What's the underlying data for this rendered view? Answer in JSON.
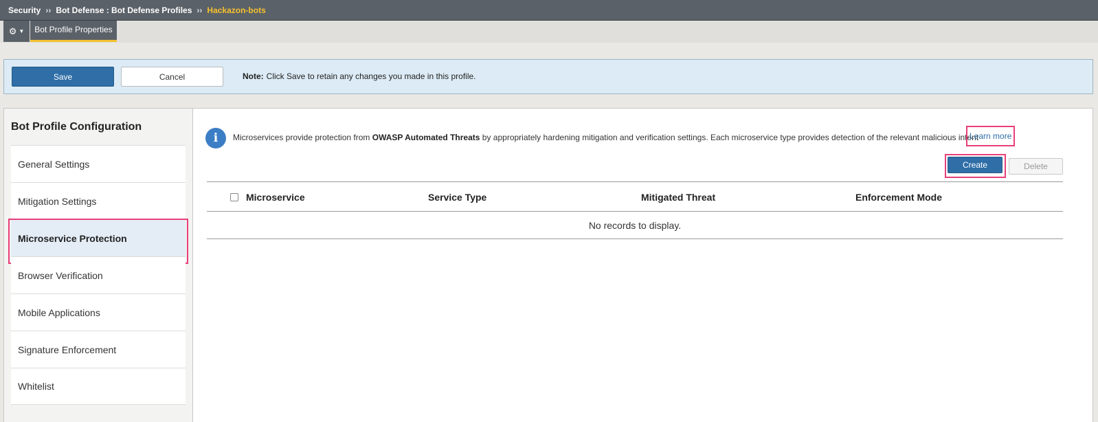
{
  "breadcrumb": {
    "items": [
      "Security",
      "Bot Defense : Bot Defense Profiles"
    ],
    "current": "Hackazon-bots",
    "separator": "››"
  },
  "tabbar": {
    "gear_icon": "gear-icon",
    "active_tab": "Bot Profile Properties"
  },
  "notice": {
    "save_label": "Save",
    "cancel_label": "Cancel",
    "note_label": "Note:",
    "note_text": "Click Save to retain any changes you made in this profile."
  },
  "sidebar": {
    "title": "Bot Profile Configuration",
    "items": [
      {
        "label": "General Settings"
      },
      {
        "label": "Mitigation Settings"
      },
      {
        "label": "Microservice Protection"
      },
      {
        "label": "Browser Verification"
      },
      {
        "label": "Mobile Applications"
      },
      {
        "label": "Signature Enforcement"
      },
      {
        "label": "Whitelist"
      }
    ],
    "active_index": 2
  },
  "main": {
    "info_pre": "Microservices provide protection from",
    "info_bold": "OWASP Automated Threats",
    "info_post": "by appropriately hardening mitigation and verification settings. Each microservice type provides detection of the relevant malicious intent",
    "learn_more": "Learn more",
    "create_label": "Create",
    "delete_label": "Delete",
    "table": {
      "columns": [
        "Microservice",
        "Service Type",
        "Mitigated Threat",
        "Enforcement Mode"
      ],
      "empty_text": "No records to display."
    }
  },
  "colors": {
    "accent": "#2f6ea7",
    "highlight": "#e83e7a",
    "breadcrumb_current": "#f5c12e"
  }
}
